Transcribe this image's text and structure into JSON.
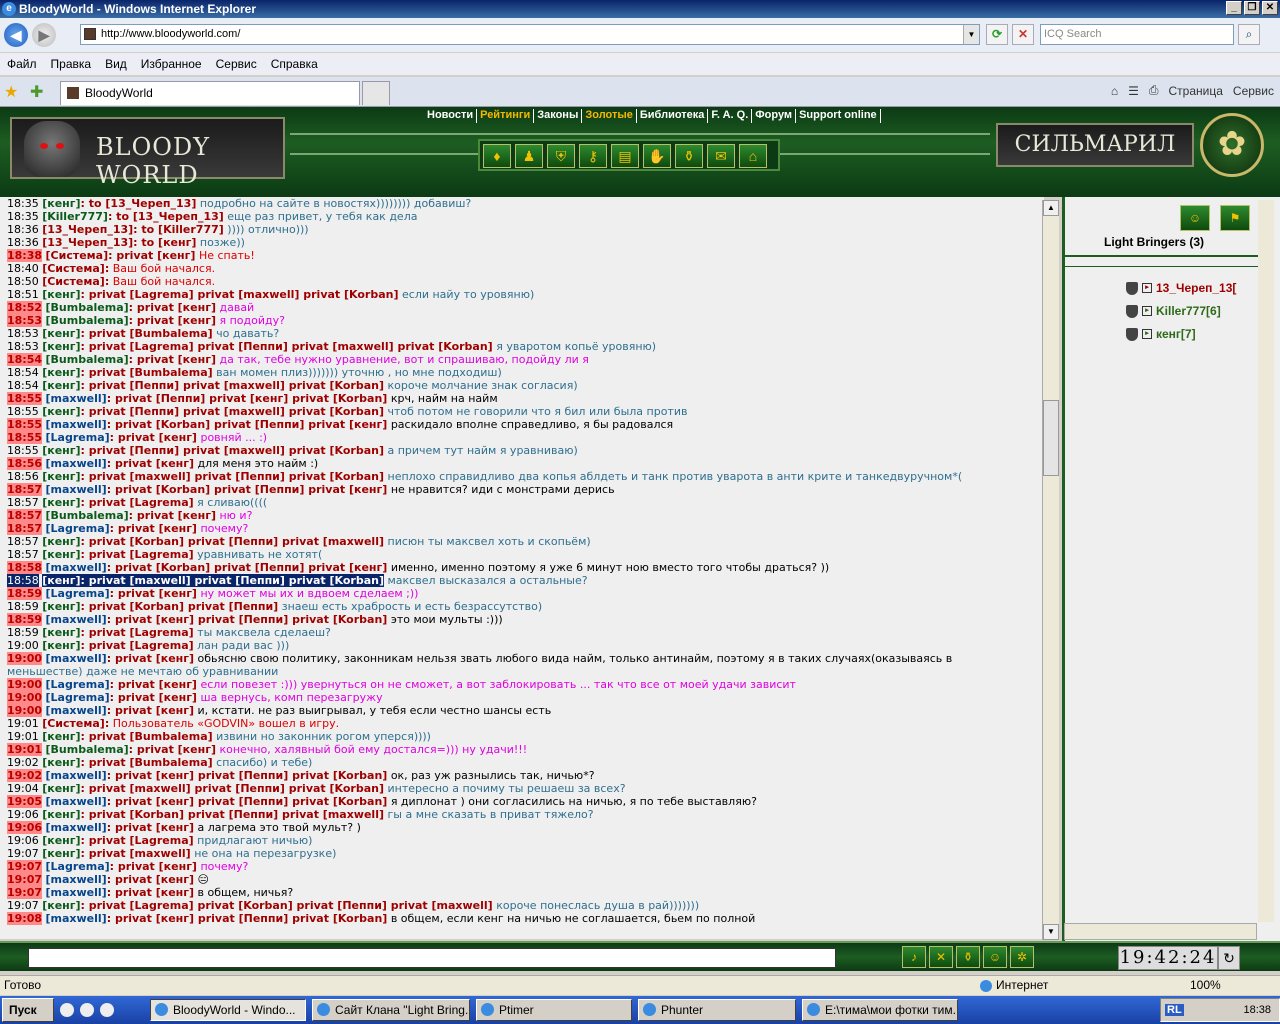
{
  "window": {
    "title": "BloodyWorld - Windows Internet Explorer"
  },
  "address": {
    "url": "http://www.bloodyworld.com/",
    "search_placeholder": "ICQ Search"
  },
  "menu": [
    "Файл",
    "Правка",
    "Вид",
    "Избранное",
    "Сервис",
    "Справка"
  ],
  "tab": {
    "title": "BloodyWorld"
  },
  "cmdbar": {
    "page": "Страница",
    "service": "Сервис"
  },
  "site": {
    "logo_left": "BLOODY WORLD",
    "logo_right": "СИЛЬМАРИЛ",
    "nav": [
      "Новости",
      "Рейтинги",
      "Законы",
      "Золотые",
      "Библиотека",
      "F. A. Q.",
      "Форум",
      "Support online"
    ]
  },
  "chat": [
    {
      "t": "18:35",
      "n": "[кенг]",
      "p": ":  to [13_Череп_13]",
      "m": "подробно на сайте в новостях)))))))) добавиш?"
    },
    {
      "t": "18:35",
      "n": "[Killer777]",
      "p": ":  to [13_Череп_13]",
      "m": "еще раз привет, у тебя как дела"
    },
    {
      "t": "18:36",
      "n": "[13_Череп_13]",
      "p": ":  to [Killer777]",
      "m": ")))) отлично)))"
    },
    {
      "t": "18:36",
      "n": "[13_Череп_13]",
      "p": ":  to [кенг]",
      "m": "позже))"
    },
    {
      "t": "18:38",
      "n": "[Система]",
      "p": ":  privat [кенг]",
      "m": "Не спать!"
    },
    {
      "t": "18:40",
      "n": "[Система]",
      "p": ":",
      "m": "Ваш бой начался."
    },
    {
      "t": "18:50",
      "n": "[Система]",
      "p": ":",
      "m": "Ваш бой начался."
    },
    {
      "t": "18:51",
      "n": "[кенг]",
      "p": ":  privat [Lagrema] privat [maxwell] privat [Korban]",
      "m": "если найу то уровяню)"
    },
    {
      "t": "18:52",
      "n": "[Bumbalema]",
      "p": ":  privat [кенг]",
      "m": "давай"
    },
    {
      "t": "18:53",
      "n": "[Bumbalema]",
      "p": ":  privat [кенг]",
      "m": "я подойду?"
    },
    {
      "t": "18:53",
      "n": "[кенг]",
      "p": ":  privat [Bumbalema]",
      "m": "чо давать?"
    },
    {
      "t": "18:53",
      "n": "[кенг]",
      "p": ":  privat [Lagrema] privat [Пеппи] privat [maxwell] privat [Korban]",
      "m": "я уваротом копьё уровяню)"
    },
    {
      "t": "18:54",
      "n": "[Bumbalema]",
      "p": ":  privat [кенг]",
      "m": "да так, тебе нужно уравнение, вот и спрашиваю, подойду ли я"
    },
    {
      "t": "18:54",
      "n": "[кенг]",
      "p": ":  privat [Bumbalema]",
      "m": "ван момен плиз))))))) уточню , но мне подходиш)"
    },
    {
      "t": "18:54",
      "n": "[кенг]",
      "p": ":  privat [Пеппи] privat [maxwell] privat [Korban]",
      "m": "короче молчание знак согласия)"
    },
    {
      "t": "18:55",
      "n": "[maxwell]",
      "p": ":  privat [Пеппи] privat [кенг] privat [Korban]",
      "m": "крч, найм на найм"
    },
    {
      "t": "18:55",
      "n": "[кенг]",
      "p": ":  privat [Пеппи] privat [maxwell] privat [Korban]",
      "m": "чтоб потом не говорили что я бил или была против"
    },
    {
      "t": "18:55",
      "n": "[maxwell]",
      "p": ":  privat [Korban] privat [Пеппи] privat [кенг]",
      "m": "раскидало вполне справедливо, я бы радовался"
    },
    {
      "t": "18:55",
      "n": "[Lagrema]",
      "p": ":  privat [кенг]",
      "m": "ровняй ... :)"
    },
    {
      "t": "18:55",
      "n": "[кенг]",
      "p": ":  privat [Пеппи] privat [maxwell] privat [Korban]",
      "m": "а причем тут найм я уравниваю)"
    },
    {
      "t": "18:56",
      "n": "[maxwell]",
      "p": ":  privat [кенг]",
      "m": "для меня это найм :)"
    },
    {
      "t": "18:56",
      "n": "[кенг]",
      "p": ":  privat [maxwell] privat [Пеппи] privat [Korban]",
      "m": "неплохо справидливо два копья аблдеть и танк против уварота в анти крите и танкедвуручном*("
    },
    {
      "t": "18:57",
      "n": "[maxwell]",
      "p": ":  privat [Korban] privat [Пеппи] privat [кенг]",
      "m": "не нравится? иди с монстрами дерись"
    },
    {
      "t": "18:57",
      "n": "[кенг]",
      "p": ":  privat [Lagrema]",
      "m": "я сливаю(((("
    },
    {
      "t": "18:57",
      "n": "[Bumbalema]",
      "p": ":  privat [кенг]",
      "m": "ню и?"
    },
    {
      "t": "18:57",
      "n": "[Lagrema]",
      "p": ":  privat [кенг]",
      "m": "почему?"
    },
    {
      "t": "18:57",
      "n": "[кенг]",
      "p": ":  privat [Korban] privat [Пеппи] privat [maxwell]",
      "m": "писюн ты максвел хоть и скопьём)"
    },
    {
      "t": "18:57",
      "n": "[кенг]",
      "p": ":  privat [Lagrema]",
      "m": "уравнивать не хотят("
    },
    {
      "t": "18:58",
      "n": "[maxwell]",
      "p": ":  privat [Korban] privat [Пеппи] privat [кенг]",
      "m": "именно, именно поэтому я уже 6 минут ною вместо того чтобы драться? ))"
    },
    {
      "t": "18:58",
      "n": "[кенг]",
      "p": ":  privat [maxwell] privat [Пеппи] privat [Korban]",
      "m": "максвел высказался а остальные?"
    },
    {
      "t": "18:59",
      "n": "[Lagrema]",
      "p": ":  privat [кенг]",
      "m": "ну может мы их и вдвоем сделаем ;))"
    },
    {
      "t": "18:59",
      "n": "[кенг]",
      "p": ":  privat [Korban] privat [Пеппи]",
      "m": "знаеш есть храбрость и есть безрассутство)"
    },
    {
      "t": "18:59",
      "n": "[maxwell]",
      "p": ":  privat [кенг] privat [Пеппи] privat [Korban]",
      "m": "это мои мульты :)))"
    },
    {
      "t": "18:59",
      "n": "[кенг]",
      "p": ":  privat [Lagrema]",
      "m": "ты максвела сделаеш?"
    },
    {
      "t": "19:00",
      "n": "[кенг]",
      "p": ":  privat [Lagrema]",
      "m": "лан ради вас )))"
    },
    {
      "t": "19:00",
      "n": "[maxwell]",
      "p": ":  privat [кенг]",
      "m": "обьясню свою политику, законникам нельзя звать любого вида найм, только антинайм, поэтому я в таких случаях(оказываясь в"
    },
    {
      "t": "",
      "n": "",
      "p": "",
      "m": "меньшестве) даже не мечтаю об уравнивании"
    },
    {
      "t": "19:00",
      "n": "[Lagrema]",
      "p": ":  privat [кенг]",
      "m": "если повезет :))) увернуться он не сможет, а вот заблокировать ... так что все от моей удачи зависит"
    },
    {
      "t": "19:00",
      "n": "[Lagrema]",
      "p": ":  privat [кенг]",
      "m": "ша вернусь, комп перезагружу"
    },
    {
      "t": "19:00",
      "n": "[maxwell]",
      "p": ":  privat [кенг]",
      "m": "и, кстати. не раз выигрывал, у тебя если честно шансы есть"
    },
    {
      "t": "19:01",
      "n": "[Система]",
      "p": ":",
      "m": "Пользователь «GODVIN» вошел в игру."
    },
    {
      "t": "19:01",
      "n": "[кенг]",
      "p": ":  privat [Bumbalema]",
      "m": "извини но законник рогом уперся))))"
    },
    {
      "t": "19:01",
      "n": "[Bumbalema]",
      "p": ":  privat [кенг]",
      "m": "конечно, халявный бой ему достался=))) ну удачи!!!"
    },
    {
      "t": "19:02",
      "n": "[кенг]",
      "p": ":  privat [Bumbalema]",
      "m": "спасибо) и тебе)"
    },
    {
      "t": "19:02",
      "n": "[maxwell]",
      "p": ":  privat [кенг] privat [Пеппи] privat [Korban]",
      "m": "ок, раз уж разнылись так, ничью*?"
    },
    {
      "t": "19:04",
      "n": "[кенг]",
      "p": ":  privat [maxwell] privat [Пеппи] privat [Korban]",
      "m": "интересно а почиму ты решаеш за всех?"
    },
    {
      "t": "19:05",
      "n": "[maxwell]",
      "p": ":  privat [кенг] privat [Пеппи] privat [Korban]",
      "m": "я диплонат ) они согласились на ничью, я по тебе выставляю?"
    },
    {
      "t": "19:06",
      "n": "[кенг]",
      "p": ":  privat [Korban] privat [Пеппи] privat [maxwell]",
      "m": "гы а мне сказать в приват тяжело?"
    },
    {
      "t": "19:06",
      "n": "[maxwell]",
      "p": ":  privat [кенг]",
      "m": "а лагрема это твой мульт? )"
    },
    {
      "t": "19:06",
      "n": "[кенг]",
      "p": ":  privat [Lagrema]",
      "m": "придлагают ничью)"
    },
    {
      "t": "19:07",
      "n": "[кенг]",
      "p": ":  privat [maxwell]",
      "m": "не она на перезагрузке)"
    },
    {
      "t": "19:07",
      "n": "[Lagrema]",
      "p": ":  privat [кенг]",
      "m": "почему?"
    },
    {
      "t": "19:07",
      "n": "[maxwell]",
      "p": ":  privat [кенг]",
      "m": "😑"
    },
    {
      "t": "19:07",
      "n": "[maxwell]",
      "p": ":  privat [кенг]",
      "m": "в общем, ничья?"
    },
    {
      "t": "19:07",
      "n": "[кенг]",
      "p": ":  privat [Lagrema] privat [Korban] privat [Пеппи] privat [maxwell]",
      "m": "короче понеслась душа в рай)))))))"
    },
    {
      "t": "19:08",
      "n": "[maxwell]",
      "p": ":  privat [кенг] privat [Пеппи] privat [Korban]",
      "m": "в общем, если кенг на ничью не соглашается, бьем по полной"
    }
  ],
  "clan": {
    "name": "Light Bringers (3)",
    "members": [
      "13_Череп_13[",
      "Killer777[6]",
      "кенг[7]"
    ]
  },
  "clock": "19:42:24",
  "status": {
    "ready": "Готово",
    "zone": "Интернет",
    "zoom": "100%"
  },
  "taskbar": {
    "start": "Пуск",
    "tasks": [
      "BloodyWorld - Windo...",
      "Сайт Клана \"Light Bring...",
      "Ptimer",
      "Phunter",
      "E:\\тима\\мои фотки тим..."
    ],
    "lang": "RL",
    "time": "18:38"
  }
}
